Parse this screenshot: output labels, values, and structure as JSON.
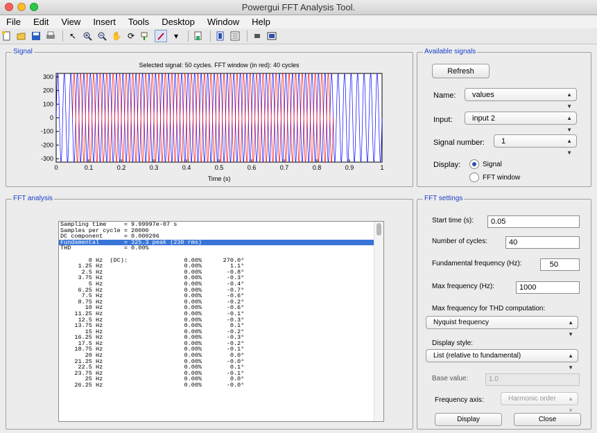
{
  "window": {
    "title": "Powergui FFT Analysis Tool."
  },
  "menu": [
    "File",
    "Edit",
    "View",
    "Insert",
    "Tools",
    "Desktop",
    "Window",
    "Help"
  ],
  "toolbar_icons": [
    "new-file-icon",
    "open-folder-icon",
    "save-icon",
    "print-icon",
    "pointer-icon",
    "zoom-in-icon",
    "zoom-out-icon",
    "pan-hand-icon",
    "rotate-3d-icon",
    "data-cursor-icon",
    "brush-icon",
    "link-icon",
    "colorbar-icon",
    "legend-icon",
    "hide-plot-tools-icon",
    "show-plot-tools-icon"
  ],
  "signal_panel": {
    "label": "Signal",
    "chart_data": {
      "type": "line",
      "title": "Selected signal: 50 cycles. FFT window (in red): 40 cycles",
      "xlabel": "Time (s)",
      "ylabel": "",
      "xlim": [
        0,
        1
      ],
      "ylim": [
        -325,
        325
      ],
      "xticks": [
        "0",
        "0.1",
        "0.2",
        "0.3",
        "0.4",
        "0.5",
        "0.6",
        "0.7",
        "0.8",
        "0.9",
        "1"
      ],
      "yticks": [
        "300",
        "200",
        "100",
        "0",
        "-100",
        "-200",
        "-300"
      ],
      "series": [
        {
          "color": "#0000ff",
          "x_range": [
            0,
            1
          ],
          "cycles": 50,
          "amplitude": 325.3
        },
        {
          "color": "#ff0000",
          "x_range": [
            0.05,
            0.85
          ],
          "cycles": 40,
          "amplitude": 325.3
        }
      ]
    }
  },
  "available_signals": {
    "label": "Available signals",
    "refresh": "Refresh",
    "name_label": "Name:",
    "name_value": "values",
    "input_label": "Input:",
    "input_value": "input 2",
    "signal_number_label": "Signal number:",
    "signal_number_value": "1",
    "display_label": "Display:",
    "display_signal": "Signal",
    "display_fft": "FFT window"
  },
  "fft_analysis": {
    "label": "FFT analysis",
    "header_lines": [
      "Sampling time     = 9.99997e-07 s",
      "Samples per cycle = 20000",
      "DC component      = 0.000296",
      "Fundamental       = 325.3 peak (230 rms)",
      "THD               = 0.00%"
    ],
    "selected_line": 3,
    "rows": [
      [
        "0 Hz",
        "(DC):",
        "0.00%",
        "270.0°"
      ],
      [
        "1.25 Hz",
        "",
        "0.00%",
        "1.1°"
      ],
      [
        "2.5 Hz",
        "",
        "0.00%",
        "-0.8°"
      ],
      [
        "3.75 Hz",
        "",
        "0.00%",
        "-0.3°"
      ],
      [
        "5 Hz",
        "",
        "0.00%",
        "-0.4°"
      ],
      [
        "6.25 Hz",
        "",
        "0.00%",
        "-0.7°"
      ],
      [
        "7.5 Hz",
        "",
        "0.00%",
        "-0.6°"
      ],
      [
        "8.75 Hz",
        "",
        "0.00%",
        "-0.2°"
      ],
      [
        "10 Hz",
        "",
        "0.00%",
        "-0.6°"
      ],
      [
        "11.25 Hz",
        "",
        "0.00%",
        "-0.1°"
      ],
      [
        "12.5 Hz",
        "",
        "0.00%",
        "-0.3°"
      ],
      [
        "13.75 Hz",
        "",
        "0.00%",
        "0.1°"
      ],
      [
        "15 Hz",
        "",
        "0.00%",
        "-0.2°"
      ],
      [
        "16.25 Hz",
        "",
        "0.00%",
        "-0.3°"
      ],
      [
        "17.5 Hz",
        "",
        "0.00%",
        "-0.2°"
      ],
      [
        "18.75 Hz",
        "",
        "0.00%",
        "-0.1°"
      ],
      [
        "20 Hz",
        "",
        "0.00%",
        "0.0°"
      ],
      [
        "21.25 Hz",
        "",
        "0.00%",
        "-0.0°"
      ],
      [
        "22.5 Hz",
        "",
        "0.00%",
        "0.1°"
      ],
      [
        "23.75 Hz",
        "",
        "0.00%",
        "-0.1°"
      ],
      [
        "25 Hz",
        "",
        "0.00%",
        "0.0°"
      ],
      [
        "26.25 Hz",
        "",
        "0.00%",
        "-0.0°"
      ]
    ]
  },
  "fft_settings": {
    "label": "FFT settings",
    "start_time_label": "Start time (s):",
    "start_time_value": "0.05",
    "num_cycles_label": "Number of cycles:",
    "num_cycles_value": "40",
    "fund_freq_label": "Fundamental frequency (Hz):",
    "fund_freq_value": "50",
    "max_freq_label": "Max frequency (Hz):",
    "max_freq_value": "1000",
    "max_thd_label": "Max frequency for THD computation:",
    "max_thd_value": "Nyquist frequency",
    "display_style_label": "Display style:",
    "display_style_value": "List (relative to fundamental)",
    "base_value_label": "Base value:",
    "base_value_value": "1.0",
    "freq_axis_label": "Frequency axis:",
    "freq_axis_value": "Harmonic order",
    "display_button": "Display",
    "close_button": "Close"
  }
}
